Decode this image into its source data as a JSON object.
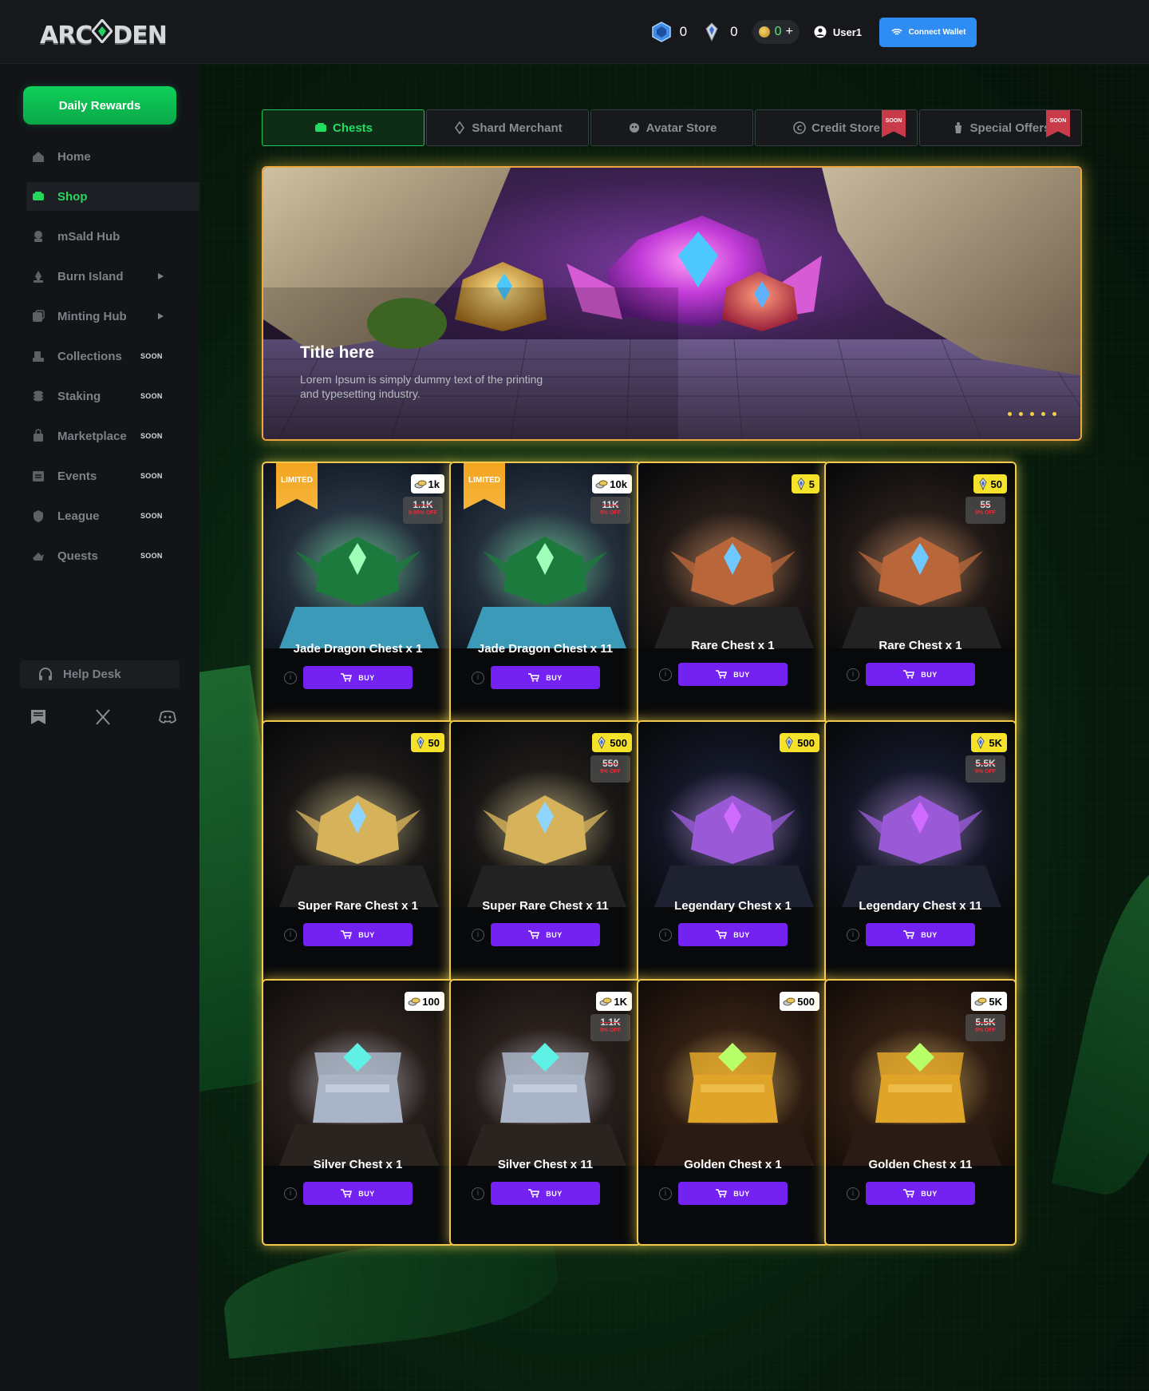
{
  "header": {
    "logo_text": "ARCADEN",
    "balances": {
      "gem_a": "0",
      "shard": "0",
      "coin": "0"
    },
    "coin_plus": "+",
    "username": "User1",
    "connect_wallet": "Connect Wallet"
  },
  "sidebar": {
    "daily_rewards": "Daily Rewards",
    "items": [
      {
        "label": "Home",
        "icon": "home-icon",
        "soon": "",
        "arrow": false,
        "active": false
      },
      {
        "label": "Shop",
        "icon": "shop-icon",
        "soon": "",
        "arrow": false,
        "active": true
      },
      {
        "label": "mSald Hub",
        "icon": "hub-icon",
        "soon": "",
        "arrow": false,
        "active": false
      },
      {
        "label": "Burn Island",
        "icon": "burn-icon",
        "soon": "",
        "arrow": true,
        "active": false
      },
      {
        "label": "Minting Hub",
        "icon": "minting-icon",
        "soon": "",
        "arrow": true,
        "active": false
      },
      {
        "label": "Collections",
        "icon": "collections-icon",
        "soon": "SOON",
        "arrow": false,
        "active": false
      },
      {
        "label": "Staking",
        "icon": "staking-icon",
        "soon": "SOON",
        "arrow": false,
        "active": false
      },
      {
        "label": "Marketplace",
        "icon": "marketplace-icon",
        "soon": "SOON",
        "arrow": false,
        "active": false
      },
      {
        "label": "Events",
        "icon": "events-icon",
        "soon": "SOON",
        "arrow": false,
        "active": false
      },
      {
        "label": "League",
        "icon": "league-icon",
        "soon": "SOON",
        "arrow": false,
        "active": false
      },
      {
        "label": "Quests",
        "icon": "quests-icon",
        "soon": "SOON",
        "arrow": false,
        "active": false
      }
    ],
    "help_desk": "Help Desk"
  },
  "tabs": [
    {
      "label": "Chests",
      "soon": ""
    },
    {
      "label": "Shard Merchant",
      "soon": ""
    },
    {
      "label": "Avatar Store",
      "soon": ""
    },
    {
      "label": "Credit Store",
      "soon": "SOON"
    },
    {
      "label": "Special Offers",
      "soon": "SOON"
    }
  ],
  "banner": {
    "title": "Title here",
    "text": "Lorem Ipsum is simply dummy text of the printing and typesetting industry.",
    "slides": 5
  },
  "cards": [
    {
      "name": "Jade Dragon Chest x 1",
      "price": "1k",
      "currency": "coin",
      "old_price": "1.1K",
      "off": "9.09% OFF",
      "limited": "LIMITED",
      "art": "jade",
      "buy": "BUY"
    },
    {
      "name": "Jade Dragon Chest x 11",
      "price": "10k",
      "currency": "coin",
      "old_price": "11K",
      "off": "9% OFF",
      "limited": "LIMITED",
      "art": "jade",
      "buy": "BUY"
    },
    {
      "name": "Rare Chest x 1",
      "price": "5",
      "currency": "gem",
      "old_price": "",
      "off": "",
      "limited": "",
      "art": "rare",
      "buy": "BUY"
    },
    {
      "name": "Rare Chest x 1",
      "price": "50",
      "currency": "gem",
      "old_price": "55",
      "off": "9% OFF",
      "limited": "",
      "art": "rare",
      "buy": "BUY"
    },
    {
      "name": "Super Rare Chest x 1",
      "price": "50",
      "currency": "gem",
      "old_price": "",
      "off": "",
      "limited": "",
      "art": "super",
      "buy": "BUY"
    },
    {
      "name": "Super Rare Chest x 11",
      "price": "500",
      "currency": "gem",
      "old_price": "550",
      "off": "9% OFF",
      "limited": "",
      "art": "super",
      "buy": "BUY"
    },
    {
      "name": "Legendary Chest x 1",
      "price": "500",
      "currency": "gem",
      "old_price": "",
      "off": "",
      "limited": "",
      "art": "legend",
      "buy": "BUY"
    },
    {
      "name": "Legendary Chest x 11",
      "price": "5K",
      "currency": "gem",
      "old_price": "5.5K",
      "off": "9% OFF",
      "limited": "",
      "art": "legend",
      "buy": "BUY"
    },
    {
      "name": "Silver Chest x 1",
      "price": "100",
      "currency": "coin",
      "old_price": "",
      "off": "",
      "limited": "",
      "art": "silver",
      "buy": "BUY"
    },
    {
      "name": "Silver Chest x 11",
      "price": "1K",
      "currency": "coin",
      "old_price": "1.1K",
      "off": "9% OFF",
      "limited": "",
      "art": "silver",
      "buy": "BUY"
    },
    {
      "name": "Golden Chest x 1",
      "price": "500",
      "currency": "coin",
      "old_price": "",
      "off": "",
      "limited": "",
      "art": "golden",
      "buy": "BUY"
    },
    {
      "name": "Golden Chest x 11",
      "price": "5K",
      "currency": "coin",
      "old_price": "5.5K",
      "off": "9% OFF",
      "limited": "",
      "art": "golden",
      "buy": "BUY"
    }
  ],
  "colors": {
    "accent_green": "#22dd62",
    "buy_purple": "#7322f2",
    "card_border": "#f2c94c",
    "wallet_blue": "#2f8cf2",
    "soon_red": "#c93b49"
  }
}
